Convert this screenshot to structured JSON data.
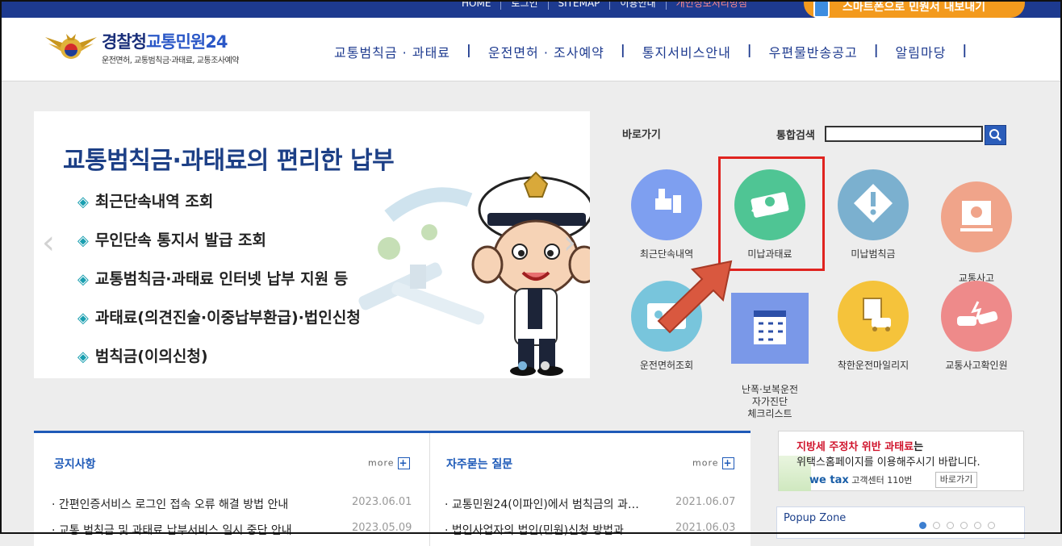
{
  "topbar": {
    "links": [
      "HOME",
      "로그인",
      "SITEMAP",
      "이용안내",
      "개인정보처리방침"
    ],
    "smart_label": "스마트폰으로 민원서 내보내기"
  },
  "header": {
    "logo_title_a": "경찰청",
    "logo_title_b": "교통민원24",
    "logo_sub": "운전면허, 교통범칙금·과태료, 교통조사예약",
    "nav": [
      "교통범칙금 · 과태료",
      "운전면허 · 조사예약",
      "통지서비스안내",
      "우편물반송공고",
      "알림마당"
    ]
  },
  "banner": {
    "title": "교통범칙금·과태료의 편리한 납부",
    "items": [
      "최근단속내역 조회",
      "무인단속 통지서 발급 조회",
      "교통범칙금·과태료 인터넷 납부 지원 등",
      "과태료(의견진술·이중납부환급)·법인신청",
      "범칙금(이의신청)"
    ],
    "bullet": "◈",
    "prev": "‹",
    "next": "›"
  },
  "quick": {
    "title": "바로가기",
    "search_label": "통합검색",
    "search_value": "",
    "items": [
      {
        "label": "최근단속내역",
        "color": "#7e9ff0"
      },
      {
        "label": "미납과태료",
        "color": "#4fc594"
      },
      {
        "label": "미납범칙금",
        "color": "#7bb0cf"
      },
      {
        "label": "교통사고\n조사예약",
        "color": "#f0a48a"
      },
      {
        "label": "운전면허조회",
        "color": "#78c5dc"
      },
      {
        "label": "난폭·보복운전\n자가진단\n체크리스트",
        "color": "#f4f4f4"
      },
      {
        "label": "착한운전마일리지",
        "color": "#f5c33b"
      },
      {
        "label": "교통사고확인원",
        "color": "#ee8a8a"
      }
    ]
  },
  "notice": {
    "title": "공지사항",
    "more": "more",
    "rows": [
      {
        "title": "간편인증서비스 로그인 접속 오류 해결 방법 안내",
        "date": "2023.06.01"
      },
      {
        "title": "교통 범칙금 및 과태료 납부서비스 일시 중단 안내",
        "date": "2023.05.09"
      }
    ]
  },
  "faq": {
    "title": "자주묻는 질문",
    "more": "more",
    "rows": [
      {
        "title": "교통민원24(이파인)에서 범칙금의 과…",
        "date": "2021.06.07"
      },
      {
        "title": "법인사업자의 법인(민원)신청 방법과 …",
        "date": "2021.06.03"
      }
    ]
  },
  "ad": {
    "line1_red": "지방세 주정차 위반 과태료",
    "line1_rest": "는",
    "line2": "위택스홈페이지를 이용해주시기 바랍니다.",
    "brand": "we tax",
    "center": "고객센터 110번",
    "go": "바로가기"
  },
  "popup": {
    "title": "Popup Zone"
  }
}
